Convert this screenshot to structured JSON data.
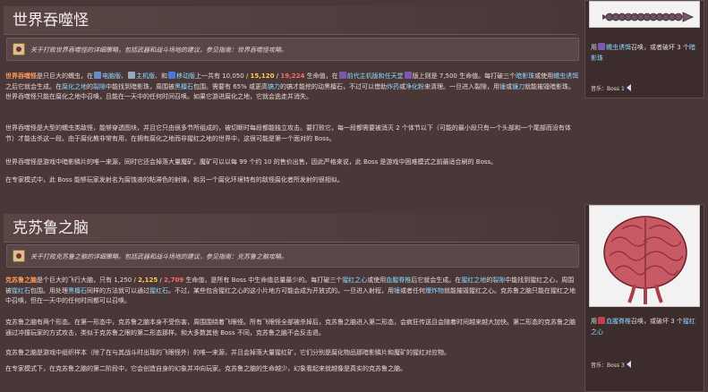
{
  "eater": {
    "title": "世界吞噬怪",
    "mainbox": "关于打败世界吞噬怪的详细策略，包括武器和战斗场地的建议，参见指南：世界吞噬怪攻略。",
    "p1": "世界吞噬怪是只巨大的蠕虫，在 电脑版、 主机版 和 移动版上一共有 10,050 / 15,120 / 19,224 生命值，在 前代主机版和任天堂 版上则是 7,500 生命值。每打破三个暗影珠或使用蠕虫诱饵之后它就会生成。在腐化之地的裂隙中能找到暗影珠，周围被黑檀石包围。需要有 65% 或更高镐力的镐才能挖的动黑檀石，不过可以借助炸药或净化粉来清理。一旦进入裂隙，用锤或镰刀就能摧毁暗影珠。世界吞噬怪只能在腐化之地中召唤，且能在一天中的任何时间召唤。如果它游进腐化之地，它就会逃走并消失。",
    "p2": "世界吞噬怪是大型的蠕虫类敌怪，能够穿透图块，并且它只由很多节所组成的，被切断时每段都能独立攻击。要打败它，每一段都需要被消灭 2 个体节以下（可能的最小段只有一个头部和一个尾部而没有体节）才能击杀这一段。由于腐化教非常有用，在拥有腐化之地而非猩红之地的世界中，这很可能是第一个面对的 Boss。",
    "p3": "世界吞噬怪是游戏中暗影鳞片的唯一来源，同时它还会掉落大量魔矿。魔矿可以以每 99 个约 10 的售价出售，因此严格来说，此 Boss 是游戏中困难模式之前最适合刷的 Boss。",
    "p4": "在专家模式中，此 Boss 能够玩家发射名为腐蚀液的粘滞色的射弹，和另一个腐化环境特有的敌怪腐化者所发射的很相似。",
    "summary": "用 蠕虫诱饵召唤，或者破坏 3 个暗影珠",
    "music": "音乐：Boss 1"
  },
  "brain": {
    "title": "克苏鲁之脑",
    "mainbox": "关于打败克苏鲁之脑的详细策略，包括武器和战斗场地的建议，参见指南：克苏鲁之脑攻略。",
    "p1": "克苏鲁之脑是个巨大的飞行大脑，只有 1,250 / 2,125 / 2,709 生命值，是所有 Boss 中生命值总量最少的。每打破三个猩红之心或使用血腥脊椎后它就会生成。在猩红之地的裂隙中能找到猩红之心，周围被猩红石包围。用处理黑檀石同样的方法就可以通过猩红石。不过，某些包含猩红之心的这小片地方可能会成为开放式的。一旦进入射程，用锤或者任何爆炸物就能摧毁猩红之心。克苏鲁之脑只能在猩红之地中召唤，但在一天中的任何时间都可以召唤。",
    "p2": "克苏鲁之脑有两个形态。在第一形态中，克苏鲁之脑本身不受伤害，周围围绕着飞眼怪。所有飞眼怪全部被杀掉后，克苏鲁之脑进入第二形态，会疯狂传送且会随着时间越来越大加快。第二形态的克苏鲁之脑通过冲撞玩家的方式攻击，类似于克苏鲁之眼的第二形态那样。和大多数其他 Boss 不同，克苏鲁之脑不会反击退。",
    "p3": "克苏鲁之脑是游戏中组织样本（除了在与其战斗时出现的飞眼怪外）的唯一来源，并且会掉落大量猩红矿，它们分别是腐化物品那暗影鳞片和魔矿的猩红对应物。",
    "p4": "在专家模式下，在克苏鲁之脑的第二阶段中，它会创造自身的幻象并冲向玩家。克苏鲁之脑的生命越少，幻象看起来就越像是真实的克苏鲁之脑。",
    "summary": "用 血腥脊椎召唤，或破坏 3 个猩红之心",
    "music": "音乐：Boss 3"
  }
}
